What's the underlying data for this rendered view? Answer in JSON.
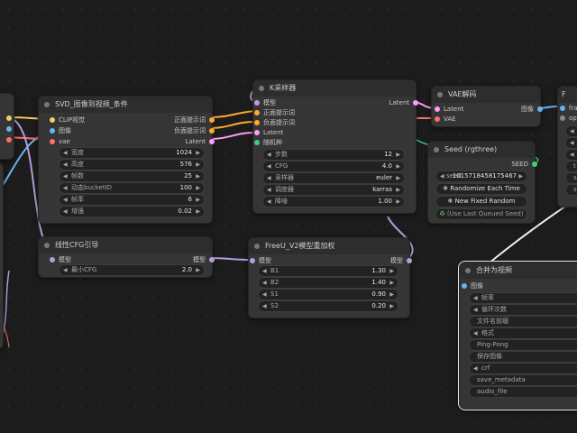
{
  "colors": {
    "clip": "#f0d060",
    "image": "#64b5f6",
    "vae": "#ff6e6e",
    "latent": "#ff9cf9",
    "model": "#b39ddb",
    "conditioning": "#ffa931",
    "int": "#3cd17f",
    "canvas": "#1c1c1c"
  },
  "svd": {
    "title": "SVD_图像到视频_条件",
    "inputs": [
      "CLIP视觉",
      "图像",
      "vae"
    ],
    "outputs": [
      "正面提示词",
      "负面提示词",
      "Latent"
    ],
    "widgets": [
      {
        "label": "宽度",
        "value": "1024"
      },
      {
        "label": "高度",
        "value": "576"
      },
      {
        "label": "帧数",
        "value": "25"
      },
      {
        "label": "动态bucketID",
        "value": "100"
      },
      {
        "label": "帧率",
        "value": "6"
      },
      {
        "label": "增强",
        "value": "0.02"
      }
    ]
  },
  "ksampler": {
    "title": "K采样器",
    "inputs": [
      "模型",
      "正面提示词",
      "负面提示词",
      "Latent",
      "随机种"
    ],
    "output": "Latent",
    "widgets": [
      {
        "label": "步数",
        "value": "12"
      },
      {
        "label": "CFG",
        "value": "4.0"
      },
      {
        "label": "采样器",
        "value": "euler"
      },
      {
        "label": "调度器",
        "value": "karras"
      },
      {
        "label": "降噪",
        "value": "1.00"
      }
    ]
  },
  "vae_decode": {
    "title": "VAE解码",
    "inputs": [
      "Latent",
      "VAE"
    ],
    "output": "图像"
  },
  "seed": {
    "title": "Seed (rgthree)",
    "output": "SEED",
    "seed_label": "seed",
    "seed_value": "1015718458175467",
    "buttons": [
      "Randomize Each Time",
      "New Fixed Random"
    ],
    "button_icon": "❄",
    "last_queued": "(Use Last Queued Seed)"
  },
  "cfg_guide": {
    "title": "线性CFG引导",
    "input": "模型",
    "output": "模型",
    "widgets": [
      {
        "label": "最小CFG",
        "value": "2.0"
      }
    ]
  },
  "freeu": {
    "title": "FreeU_V2模型重加权",
    "input": "模型",
    "output": "模型",
    "widgets": [
      {
        "label": "B1",
        "value": "1.30"
      },
      {
        "label": "B2",
        "value": "1.40"
      },
      {
        "label": "S1",
        "value": "0.90"
      },
      {
        "label": "S2",
        "value": "0.20"
      }
    ]
  },
  "combine": {
    "title": "合并为视频",
    "input": "图像",
    "widgets": [
      "帧率",
      "循环次数",
      "文件名前缀",
      "格式",
      "Ping-Pong",
      "保存图像",
      "crf",
      "save_metadata",
      "audio_file"
    ]
  },
  "right_partial": {
    "title": "F",
    "inputs": [
      "fra",
      "opti"
    ],
    "widgets": [
      "f",
      "l",
      "s",
      "t",
      "s",
      "s"
    ]
  }
}
